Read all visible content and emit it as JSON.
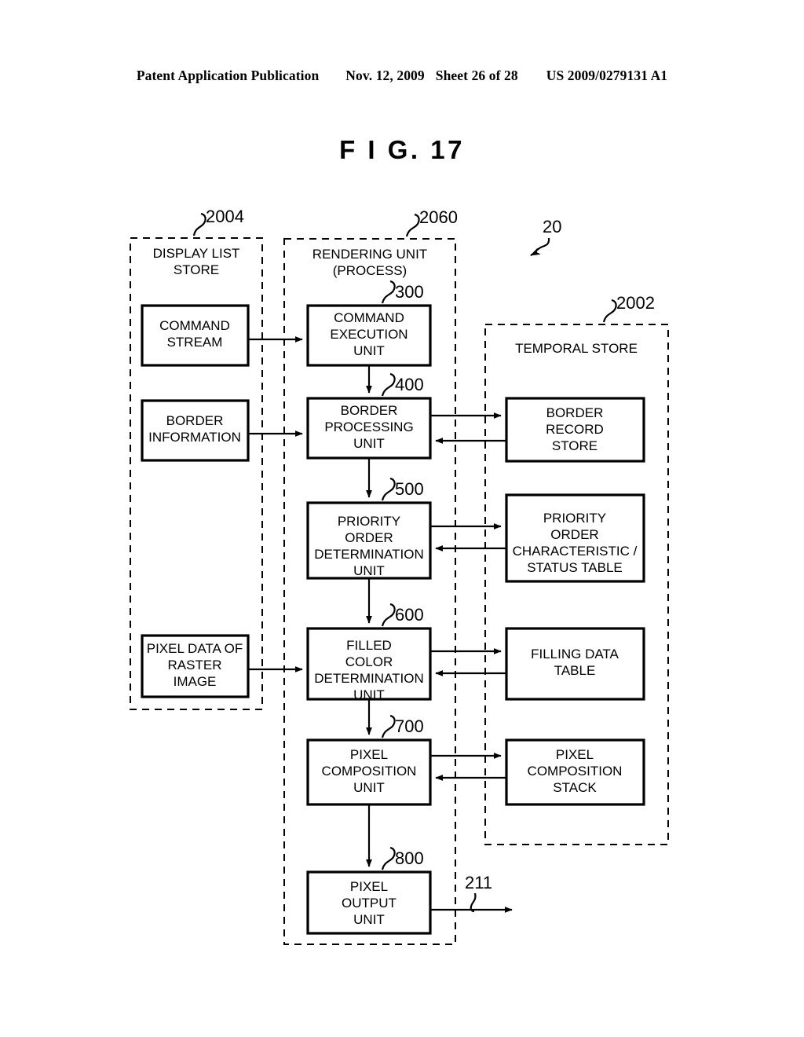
{
  "header": {
    "publication": "Patent Application Publication",
    "date": "Nov. 12, 2009",
    "sheet": "Sheet 26 of 28",
    "docnum": "US 2009/0279131 A1"
  },
  "figure": {
    "title": "F I G.  17",
    "overall_ref": "20",
    "output_ref": "211"
  },
  "containers": [
    {
      "id": "display-list-store",
      "label": "DISPLAY LIST\nSTORE",
      "label_lines": [
        "DISPLAY LIST",
        "STORE"
      ],
      "ref": "2004"
    },
    {
      "id": "rendering-unit",
      "label": "RENDERING UNIT\n(PROCESS)",
      "label_lines": [
        "RENDERING UNIT",
        "(PROCESS)"
      ],
      "ref": "2060"
    },
    {
      "id": "temporal-store",
      "label": "TEMPORAL STORE",
      "label_lines": [
        "TEMPORAL STORE"
      ],
      "ref": "2002"
    }
  ],
  "blocks": [
    {
      "id": "command-stream",
      "lines": [
        "COMMAND",
        "STREAM"
      ],
      "ref": ""
    },
    {
      "id": "border-information",
      "lines": [
        "BORDER",
        "INFORMATION"
      ],
      "ref": ""
    },
    {
      "id": "pixel-data-raster-image",
      "lines": [
        "PIXEL DATA OF",
        "RASTER",
        "IMAGE"
      ],
      "ref": ""
    },
    {
      "id": "command-execution-unit",
      "lines": [
        "COMMAND",
        "EXECUTION",
        "UNIT"
      ],
      "ref": "300"
    },
    {
      "id": "border-processing-unit",
      "lines": [
        "BORDER",
        "PROCESSING",
        "UNIT"
      ],
      "ref": "400"
    },
    {
      "id": "priority-order-determination-unit",
      "lines": [
        "PRIORITY",
        "ORDER",
        "DETERMINATION",
        "UNIT"
      ],
      "ref": "500"
    },
    {
      "id": "filled-color-determination-unit",
      "lines": [
        "FILLED",
        "COLOR",
        "DETERMINATION",
        "UNIT"
      ],
      "ref": "600"
    },
    {
      "id": "pixel-composition-unit",
      "lines": [
        "PIXEL",
        "COMPOSITION",
        "UNIT"
      ],
      "ref": "700"
    },
    {
      "id": "pixel-output-unit",
      "lines": [
        "PIXEL",
        "OUTPUT",
        "UNIT"
      ],
      "ref": "800"
    },
    {
      "id": "border-record-store",
      "lines": [
        "BORDER",
        "RECORD",
        "STORE"
      ],
      "ref": ""
    },
    {
      "id": "priority-order-characteristic-status-table",
      "lines": [
        "PRIORITY",
        "ORDER",
        "CHARACTERISTIC /",
        "STATUS TABLE"
      ],
      "ref": ""
    },
    {
      "id": "filling-data-table",
      "lines": [
        "FILLING DATA",
        "TABLE"
      ],
      "ref": ""
    },
    {
      "id": "pixel-composition-stack",
      "lines": [
        "PIXEL",
        "COMPOSITION",
        "STACK"
      ],
      "ref": ""
    }
  ]
}
